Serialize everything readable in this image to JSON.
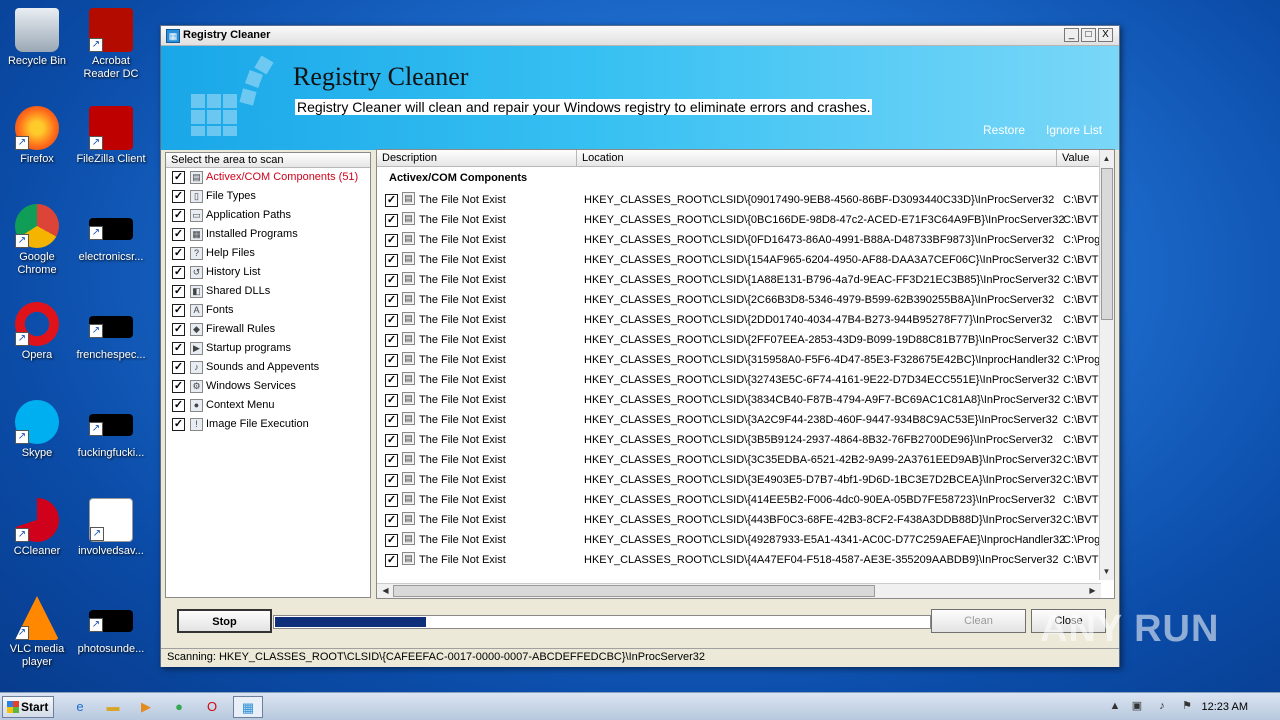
{
  "desktop": {
    "icons": [
      {
        "label": "Recycle Bin",
        "icon": "recycle-bin-icon"
      },
      {
        "label": "Acrobat Reader DC",
        "icon": "acrobat-icon"
      },
      {
        "label": "Firefox",
        "icon": "firefox-icon"
      },
      {
        "label": "FileZilla Client",
        "icon": "filezilla-icon"
      },
      {
        "label": "Google Chrome",
        "icon": "chrome-icon"
      },
      {
        "label": "electronicsr...",
        "icon": "file-icon"
      },
      {
        "label": "Opera",
        "icon": "opera-icon"
      },
      {
        "label": "frenchespec...",
        "icon": "file-icon"
      },
      {
        "label": "Skype",
        "icon": "skype-icon"
      },
      {
        "label": "fuckingfucki...",
        "icon": "file-icon"
      },
      {
        "label": "CCleaner",
        "icon": "ccleaner-icon"
      },
      {
        "label": "involvedsav...",
        "icon": "word-doc-icon"
      },
      {
        "label": "VLC media player",
        "icon": "vlc-icon"
      },
      {
        "label": "photosunde...",
        "icon": "file-icon"
      }
    ]
  },
  "window": {
    "title": "Registry Cleaner",
    "min_label": "_",
    "max_label": "□",
    "close_label": "X"
  },
  "banner": {
    "heading": "Registry Cleaner",
    "subtitle": "Registry Cleaner will clean and repair your Windows registry to eliminate errors and crashes.",
    "restore": "Restore",
    "ignore_list": "Ignore List"
  },
  "left_panel": {
    "header": "Select the area to scan",
    "categories": [
      {
        "label": "Activex/COM Components (51)",
        "icon": "activex-icon",
        "checked": true,
        "active": true
      },
      {
        "label": "File Types",
        "icon": "file-types-icon",
        "checked": true
      },
      {
        "label": "Application Paths",
        "icon": "application-paths-icon",
        "checked": true
      },
      {
        "label": "Installed Programs",
        "icon": "installed-programs-icon",
        "checked": true
      },
      {
        "label": "Help Files",
        "icon": "help-icon",
        "checked": true
      },
      {
        "label": "History List",
        "icon": "history-icon",
        "checked": true
      },
      {
        "label": "Shared DLLs",
        "icon": "dll-icon",
        "checked": true
      },
      {
        "label": "Fonts",
        "icon": "font-icon",
        "checked": true
      },
      {
        "label": "Firewall Rules",
        "icon": "firewall-shield-icon",
        "checked": true
      },
      {
        "label": "Startup programs",
        "icon": "startup-icon",
        "checked": true
      },
      {
        "label": "Sounds and Appevents",
        "icon": "sound-icon",
        "checked": true
      },
      {
        "label": "Windows Services",
        "icon": "services-icon",
        "checked": true
      },
      {
        "label": "Context Menu",
        "icon": "context-menu-icon",
        "checked": true
      },
      {
        "label": "Image File Execution",
        "icon": "warning-icon",
        "checked": true
      }
    ]
  },
  "results": {
    "columns": [
      "Description",
      "Location",
      "Value"
    ],
    "group_title": "Activex/COM Components",
    "rows": [
      {
        "description": "The File Not Exist",
        "location": "HKEY_CLASSES_ROOT\\CLSID\\{09017490-9EB8-4560-86BF-D3093440C33D}\\InProcServer32",
        "value": "C:\\BVTE"
      },
      {
        "description": "The File Not Exist",
        "location": "HKEY_CLASSES_ROOT\\CLSID\\{0BC166DE-98D8-47c2-ACED-E71F3C64A9FB}\\InProcServer32",
        "value": "C:\\BVTE"
      },
      {
        "description": "The File Not Exist",
        "location": "HKEY_CLASSES_ROOT\\CLSID\\{0FD16473-86A0-4991-B88A-D48733BF9873}\\InProcServer32",
        "value": "C:\\Prog"
      },
      {
        "description": "The File Not Exist",
        "location": "HKEY_CLASSES_ROOT\\CLSID\\{154AF965-6204-4950-AF88-DAA3A7CEF06C}\\InProcServer32",
        "value": "C:\\BVTE"
      },
      {
        "description": "The File Not Exist",
        "location": "HKEY_CLASSES_ROOT\\CLSID\\{1A88E131-B796-4a7d-9EAC-FF3D21EC3B85}\\InProcServer32",
        "value": "C:\\BVTE"
      },
      {
        "description": "The File Not Exist",
        "location": "HKEY_CLASSES_ROOT\\CLSID\\{2C66B3D8-5346-4979-B599-62B390255B8A}\\InProcServer32",
        "value": "C:\\BVTE"
      },
      {
        "description": "The File Not Exist",
        "location": "HKEY_CLASSES_ROOT\\CLSID\\{2DD01740-4034-47B4-B273-944B95278F77}\\InProcServer32",
        "value": "C:\\BVTE"
      },
      {
        "description": "The File Not Exist",
        "location": "HKEY_CLASSES_ROOT\\CLSID\\{2FF07EEA-2853-43D9-B099-19D88C81B77B}\\InProcServer32",
        "value": "C:\\BVTE"
      },
      {
        "description": "The File Not Exist",
        "location": "HKEY_CLASSES_ROOT\\CLSID\\{315958A0-F5F6-4D47-85E3-F328675E42BC}\\InprocHandler32",
        "value": "C:\\Prog"
      },
      {
        "description": "The File Not Exist",
        "location": "HKEY_CLASSES_ROOT\\CLSID\\{32743E5C-6F74-4161-9E22-D7D34ECC551E}\\InProcServer32",
        "value": "C:\\BVTE"
      },
      {
        "description": "The File Not Exist",
        "location": "HKEY_CLASSES_ROOT\\CLSID\\{3834CB40-F87B-4794-A9F7-BC69AC1C81A8}\\InProcServer32",
        "value": "C:\\BVTE"
      },
      {
        "description": "The File Not Exist",
        "location": "HKEY_CLASSES_ROOT\\CLSID\\{3A2C9F44-238D-460F-9447-934B8C9AC53E}\\InProcServer32",
        "value": "C:\\BVTE"
      },
      {
        "description": "The File Not Exist",
        "location": "HKEY_CLASSES_ROOT\\CLSID\\{3B5B9124-2937-4864-8B32-76FB2700DE96}\\InProcServer32",
        "value": "C:\\BVTE"
      },
      {
        "description": "The File Not Exist",
        "location": "HKEY_CLASSES_ROOT\\CLSID\\{3C35EDBA-6521-42B2-9A99-2A3761EED9AB}\\InProcServer32",
        "value": "C:\\BVTE"
      },
      {
        "description": "The File Not Exist",
        "location": "HKEY_CLASSES_ROOT\\CLSID\\{3E4903E5-D7B7-4bf1-9D6D-1BC3E7D2BCEA}\\InProcServer32",
        "value": "C:\\BVTE"
      },
      {
        "description": "The File Not Exist",
        "location": "HKEY_CLASSES_ROOT\\CLSID\\{414EE5B2-F006-4dc0-90EA-05BD7FE58723}\\InProcServer32",
        "value": "C:\\BVTE"
      },
      {
        "description": "The File Not Exist",
        "location": "HKEY_CLASSES_ROOT\\CLSID\\{443BF0C3-68FE-42B3-8CF2-F438A3DDB88D}\\InProcServer32",
        "value": "C:\\BVTE"
      },
      {
        "description": "The File Not Exist",
        "location": "HKEY_CLASSES_ROOT\\CLSID\\{49287933-E5A1-4341-AC0C-D77C259AEFAE}\\InprocHandler32",
        "value": "C:\\Prog"
      },
      {
        "description": "The File Not Exist",
        "location": "HKEY_CLASSES_ROOT\\CLSID\\{4A47EF04-F518-4587-AE3E-355209AABDB9}\\InProcServer32",
        "value": "C:\\BVTE"
      }
    ]
  },
  "controls": {
    "stop": "Stop",
    "clean": "Clean",
    "close": "Close",
    "progress": 0.23
  },
  "status": "Scanning: HKEY_CLASSES_ROOT\\CLSID\\{CAFEEFAC-0017-0000-0007-ABCDEFFEDCBC}\\InProcServer32",
  "taskbar": {
    "start": "Start",
    "clock": "12:23 AM"
  },
  "watermark": "ANY RUN",
  "colors": {
    "active_category": "#d0021b",
    "banner": "#1aa7e8",
    "progress_fill": "#0f2f7a"
  }
}
